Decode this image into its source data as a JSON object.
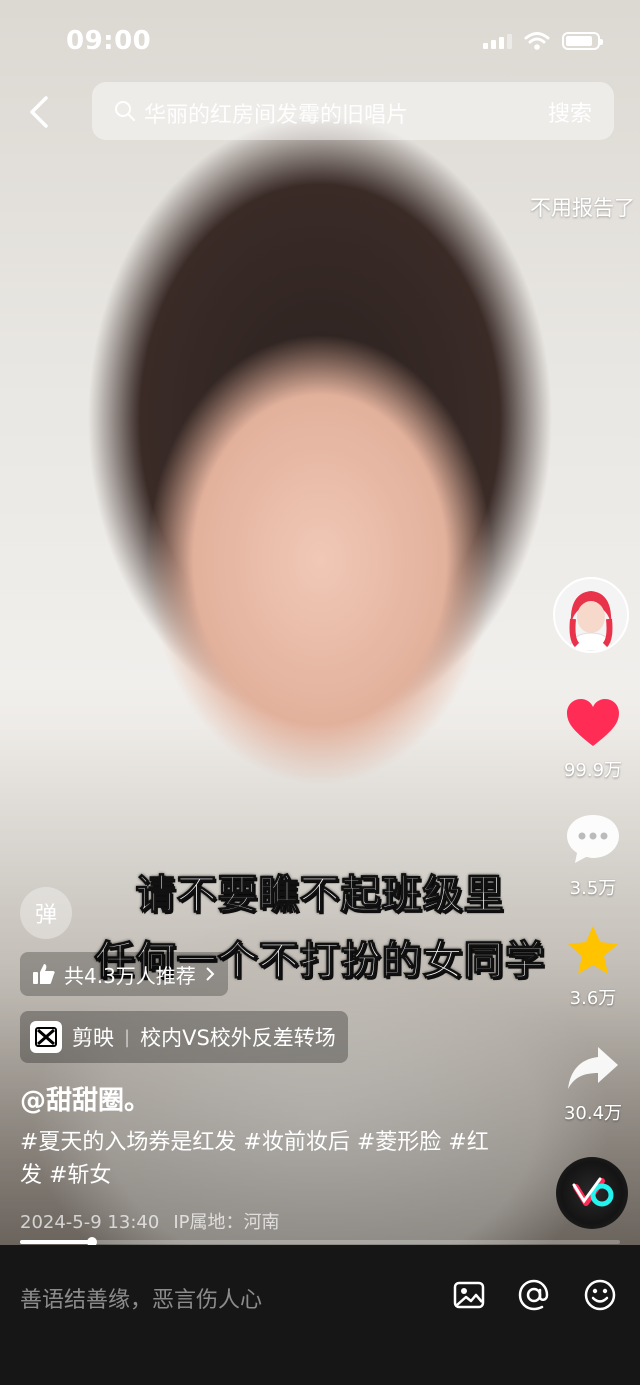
{
  "status_bar": {
    "time": "09:00"
  },
  "search": {
    "query": "华丽的红房间发霉的旧唱片",
    "button": "搜索"
  },
  "side_tag": "不用报告了",
  "actions": {
    "likes": "99.9万",
    "comments": "3.5万",
    "favorites": "3.6万",
    "shares": "30.4万"
  },
  "caption": {
    "line1": "请不要瞧不起班级里",
    "line2": "任何一个不打扮的女同学"
  },
  "danmu_label": "弹",
  "recommend": "共4.3万人推荐",
  "capcut": {
    "app": "剪映",
    "template": "校内VS校外反差转场"
  },
  "author": "@甜甜圈。",
  "description": "#夏天的入场券是红发 #妆前妆后 #菱形脸 #红发 #斩女",
  "meta": {
    "date": "2024-5-9 13:40",
    "ip": "IP属地：河南"
  },
  "progress_fraction": 0.12,
  "comment_placeholder": "善语结善缘，恶言伤人心",
  "colors": {
    "like": "#ff2c55",
    "star": "#ffc300",
    "accent": "#fe2c55"
  }
}
